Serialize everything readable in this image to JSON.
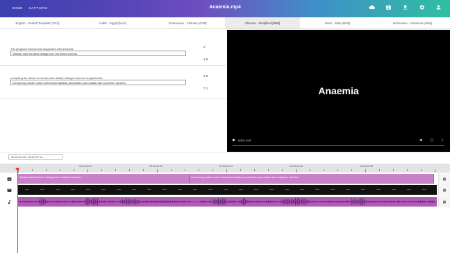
{
  "nav": {
    "home": "HOME",
    "captions": "CAPTIONS"
  },
  "title": "Anaemia.mp4",
  "toolbar_icons": [
    "cloud-icon",
    "save-icon",
    "download-icon",
    "settings-icon",
    "account-icon"
  ],
  "tabs": [
    {
      "label": "English - Default Template [72c2]",
      "active": false
    },
    {
      "label": "Arabic - Egypt [bcc4]",
      "active": false
    },
    {
      "label": "Vietnamese - Vietnam [cb76]",
      "active": false
    },
    {
      "label": "Chinese - Simplified [f98d]",
      "active": true
    },
    {
      "label": "Hindi - India [4538]",
      "active": false
    },
    {
      "label": "Indonesian - Indonesia [a26e]",
      "active": false
    }
  ],
  "subtitles": [
    {
      "original": "The pregnant woman was diagnosed with anaemia.",
      "translation": "Wanita hamil tersebut didiagnosis menderita anemia.",
      "start": "0",
      "end": "2.9"
    },
    {
      "original": "prompting the doctor to recommend dietary changes and iron supplements.",
      "translation": "mendorong dokter untuk merekomendasikan perubahan pola makan dan suplemen zat besi.",
      "start": "2.9",
      "end": "7.1"
    }
  ],
  "video": {
    "overlay_text": "Anaemia",
    "time": "0:00 / 0:07"
  },
  "timecode": "00:00:00.00 / 00:00:07.14",
  "ruler_labels": [
    "00:00:00:01",
    "00:00:00:02",
    "00:00:00:04",
    "00:00:00:05",
    "00:00:00:06"
  ],
  "caption_segments": [
    "Wanita hamil tersebut didiagnosis menderita anemia.",
    "mendorong dokter untuk merekomendasikan perubahan pola makan dan suplemen zat besi."
  ],
  "colors": {
    "segment": "#c782c9",
    "audio": "#b25cb8",
    "playhead": "#e53935"
  }
}
